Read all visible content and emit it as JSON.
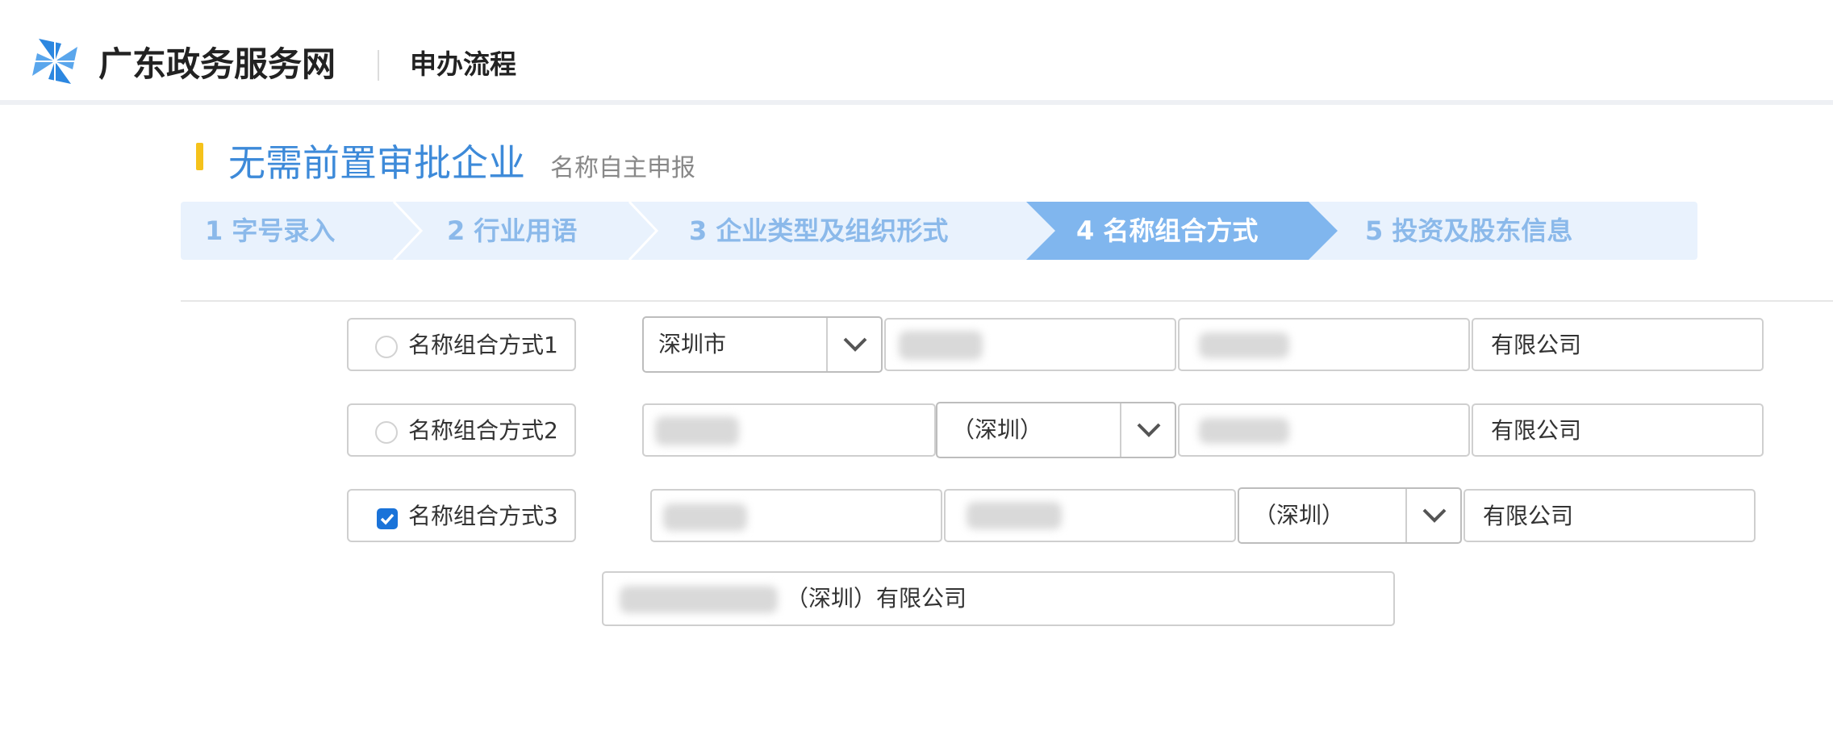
{
  "header": {
    "site_name": "广东政务服务网",
    "sub_title": "申办流程",
    "logo_icon": "pinwheel-icon",
    "brand_color": "#2c87e0"
  },
  "page": {
    "title": "无需前置审批企业",
    "subtitle": "名称自主申报",
    "accent_color": "#f5c21b",
    "title_color": "#3d8ad9"
  },
  "steps": [
    {
      "label": "1 字号录入",
      "active": false
    },
    {
      "label": "2 行业用语",
      "active": false
    },
    {
      "label": "3 企业类型及组织形式",
      "active": false
    },
    {
      "label": "4 名称组合方式",
      "active": true
    },
    {
      "label": "5 投资及股东信息",
      "active": false
    }
  ],
  "step_colors": {
    "inactive_bg": "#e9f2fd",
    "inactive_text": "#8bb9ea",
    "active_bg": "#80b6ee",
    "active_text": "#ffffff"
  },
  "options": [
    {
      "label": "名称组合方式1",
      "checked": false,
      "region_select": "深圳市",
      "suffix": "有限公司"
    },
    {
      "label": "名称组合方式2",
      "checked": false,
      "region_select": "（深圳）",
      "suffix": "有限公司"
    },
    {
      "label": "名称组合方式3",
      "checked": true,
      "region_select": "（深圳）",
      "suffix": "有限公司"
    }
  ],
  "preview": {
    "text": "（深圳）有限公司"
  },
  "icons": {
    "select_arrow": "chevron-down-icon",
    "check": "checkmark-icon"
  }
}
